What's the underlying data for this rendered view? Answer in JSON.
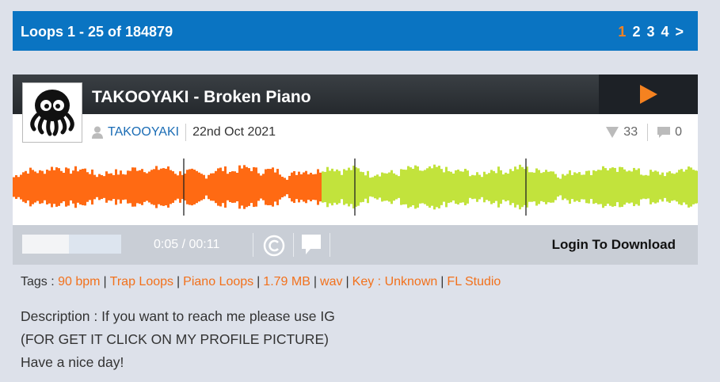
{
  "pager": {
    "title": "Loops 1 - 25 of 184879",
    "pages": [
      "1",
      "2",
      "3",
      "4",
      ">"
    ],
    "current_page": "1"
  },
  "loop": {
    "title": "TAKOOYAKI - Broken Piano",
    "author": "TAKOOYAKI",
    "date": "22nd Oct 2021",
    "downloads": "33",
    "comments": "0",
    "time_current": "0:05",
    "time_sep": "/",
    "time_total": "00:11",
    "playback_progress": 0.45,
    "login_label": "Login To Download",
    "colors": {
      "played": "#ff6a13",
      "unplayed": "#c2e33c",
      "accent": "#f58220",
      "header": "#0a74c2"
    }
  },
  "tags": {
    "prefix": "Tags :",
    "items": [
      "90 bpm",
      "Trap Loops",
      "Piano Loops",
      "1.79 MB",
      "wav",
      "Key : Unknown"
    ],
    "last": "FL Studio"
  },
  "description": {
    "line1": "Description : If you want to reach me please use IG",
    "line2": "(FOR GET IT CLICK ON MY PROFILE PICTURE)",
    "line3": "Have a nice day!"
  },
  "icons": [
    "user-icon",
    "play-icon",
    "download-triangle-icon",
    "comment-icon",
    "copyright-icon",
    "speech-bubble-icon"
  ]
}
